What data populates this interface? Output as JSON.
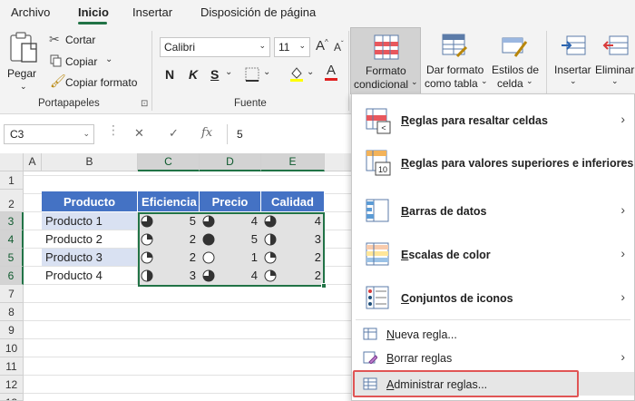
{
  "tabs": [
    "Archivo",
    "Inicio",
    "Insertar",
    "Disposición de página"
  ],
  "active_tab": "Inicio",
  "ribbon": {
    "clipboard": {
      "paste": "Pegar",
      "cut": "Cortar",
      "copy": "Copiar",
      "format_painter": "Copiar formato",
      "group_label": "Portapapeles"
    },
    "font": {
      "name": "Calibri",
      "size": "11",
      "bold": "N",
      "italic": "K",
      "underline": "S",
      "group_label": "Fuente"
    },
    "styles": {
      "conditional_format": [
        "Formato",
        "condicional"
      ],
      "format_as_table": [
        "Dar formato",
        "como tabla"
      ],
      "cell_styles": [
        "Estilos de",
        "celda"
      ]
    },
    "cells": {
      "insert": "Insertar",
      "delete": "Eliminar"
    }
  },
  "formula_bar": {
    "name_box": "C3",
    "fx": "fx",
    "value": "5"
  },
  "columns": [
    "A",
    "B",
    "C",
    "D",
    "E"
  ],
  "rows": [
    "1",
    "2",
    "3",
    "4",
    "5",
    "6",
    "7",
    "8",
    "9",
    "10",
    "11",
    "12",
    "13"
  ],
  "table": {
    "headers": [
      "Producto",
      "Eficiencia",
      "Precio",
      "Calidad"
    ],
    "rows": [
      {
        "name": "Producto 1",
        "values": [
          5,
          4,
          4
        ],
        "harvey": [
          0.75,
          0.75,
          0.75
        ]
      },
      {
        "name": "Producto 2",
        "values": [
          2,
          5,
          3
        ],
        "harvey": [
          0.25,
          1.0,
          0.5
        ]
      },
      {
        "name": "Producto 3",
        "values": [
          2,
          1,
          2
        ],
        "harvey": [
          0.25,
          0.0,
          0.25
        ]
      },
      {
        "name": "Producto 4",
        "values": [
          3,
          4,
          2
        ],
        "harvey": [
          0.5,
          0.75,
          0.25
        ]
      }
    ]
  },
  "menu": {
    "items": [
      {
        "label": "Reglas para resaltar celdas",
        "accel": "R",
        "submenu": true
      },
      {
        "label": "Reglas para valores superiores e inferiores",
        "accel": "R",
        "submenu": true
      },
      {
        "label": "Barras de datos",
        "accel": "B",
        "submenu": true
      },
      {
        "label": "Escalas de color",
        "accel": "E",
        "submenu": true
      },
      {
        "label": "Conjuntos de iconos",
        "accel": "C",
        "submenu": true
      }
    ],
    "small_items": [
      {
        "label": "Nueva regla...",
        "accel": "N",
        "submenu": false
      },
      {
        "label": "Borrar reglas",
        "accel": "B",
        "submenu": true
      },
      {
        "label": "Administrar reglas...",
        "accel": "A",
        "submenu": false
      }
    ]
  },
  "colors": {
    "accent": "#217346",
    "header_fill": "#4472c4",
    "band_fill": "#d9e1f2",
    "highlight": "#e05555"
  }
}
